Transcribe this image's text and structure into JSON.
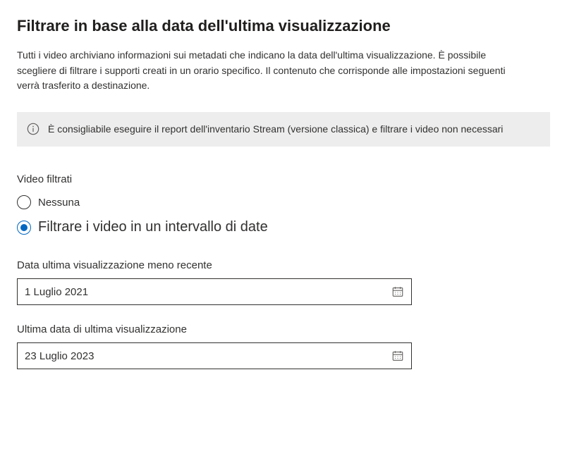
{
  "header": {
    "title": "Filtrare in base alla data dell'ultima visualizzazione",
    "description": "Tutti i video archiviano informazioni sui metadati che indicano la data dell'ultima visualizzazione. È possibile scegliere di filtrare i supporti creati in un orario specifico. Il contenuto che corrisponde alle impostazioni seguenti verrà trasferito a destinazione."
  },
  "infoBox": {
    "text": "È consigliabile eseguire il report dell'inventario Stream (versione classica) e filtrare i video non necessari"
  },
  "filter": {
    "groupLabel": "Video filtrati",
    "options": {
      "none": {
        "label": "Nessuna",
        "selected": false
      },
      "range": {
        "label": "Filtrare i video in un intervallo di date",
        "selected": true
      }
    }
  },
  "dateFields": {
    "oldest": {
      "label": "Data ultima visualizzazione meno recente",
      "value": "1 Luglio 2021"
    },
    "latest": {
      "label": "Ultima data di ultima visualizzazione",
      "value": "23 Luglio 2023"
    }
  },
  "icons": {
    "info": "info-icon",
    "calendar": "calendar-icon"
  }
}
